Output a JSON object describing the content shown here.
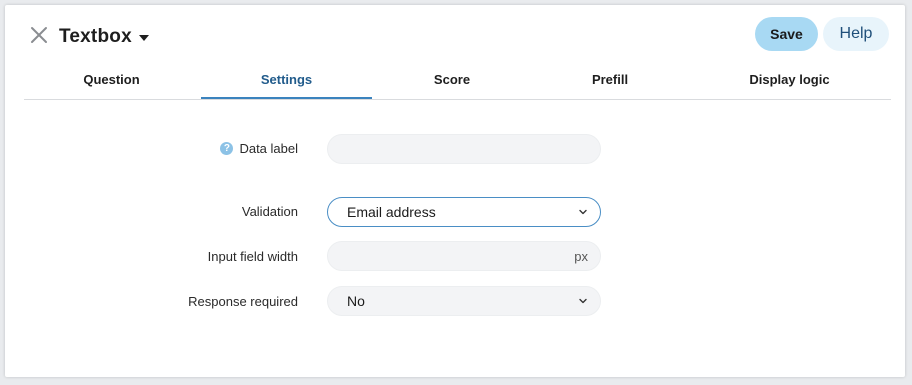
{
  "header": {
    "title": "Textbox",
    "save_label": "Save",
    "help_label": "Help"
  },
  "tabs": [
    {
      "label": "Question",
      "active": false
    },
    {
      "label": "Settings",
      "active": true
    },
    {
      "label": "Score",
      "active": false
    },
    {
      "label": "Prefill",
      "active": false
    },
    {
      "label": "Display logic",
      "active": false
    }
  ],
  "form": {
    "data_label": {
      "label": "Data label",
      "value": "",
      "icon": "question-circle-icon"
    },
    "validation": {
      "label": "Validation",
      "value": "Email address"
    },
    "input_width": {
      "label": "Input field width",
      "value": "",
      "unit": "px"
    },
    "response_required": {
      "label": "Response required",
      "value": "No"
    }
  },
  "colors": {
    "accent": "#3b83be",
    "save_bg": "#a8d9f3",
    "help_bg": "#e8f4fb",
    "active_tab_text": "#225c8c"
  }
}
